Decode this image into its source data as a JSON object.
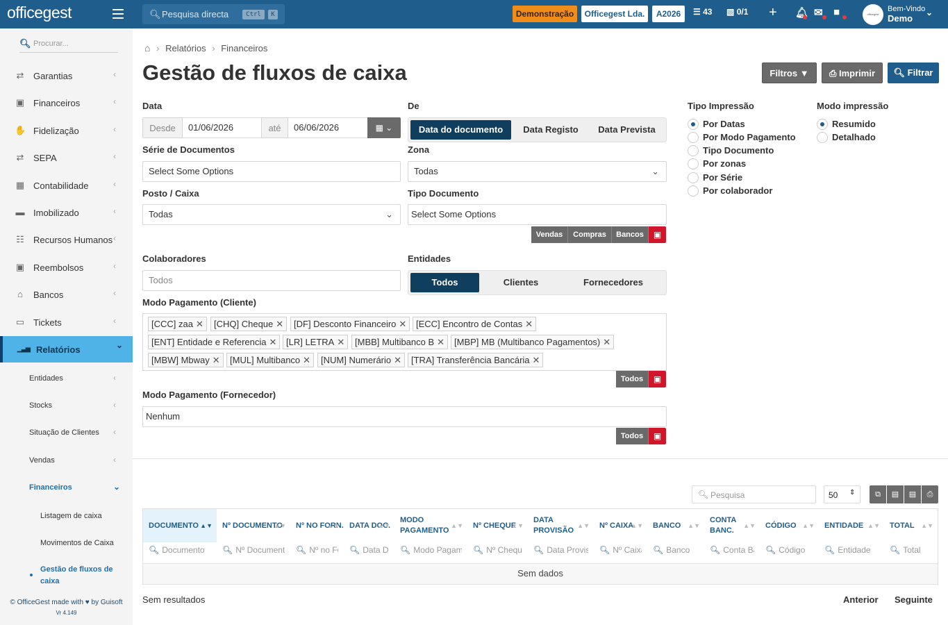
{
  "topbar": {
    "logo": "officegest",
    "search_placeholder": "Pesquisa directa",
    "kbd_ctrl": "Ctrl",
    "kbd_k": "K",
    "demo_badge": "Demonstração",
    "company": "Officegest Lda.",
    "year": "A2026",
    "tasks_count": "43",
    "folders_count": "0/1",
    "welcome": "Bem-Vindo",
    "user": "Demo"
  },
  "sidebar": {
    "search_placeholder": "Procurar...",
    "items": [
      {
        "label": "Garantias",
        "icon": "arrows-exchange-icon"
      },
      {
        "label": "Financeiros",
        "icon": "money-icon"
      },
      {
        "label": "Fidelização",
        "icon": "hand-coin-icon"
      },
      {
        "label": "SEPA",
        "icon": "arrows-exchange-icon"
      },
      {
        "label": "Contabilidade",
        "icon": "calculator-icon"
      },
      {
        "label": "Imobilizado",
        "icon": "truck-icon"
      },
      {
        "label": "Recursos Humanos",
        "icon": "sitemap-icon"
      },
      {
        "label": "Reembolsos",
        "icon": "money-icon"
      },
      {
        "label": "Bancos",
        "icon": "bank-icon"
      },
      {
        "label": "Tickets",
        "icon": "ticket-icon"
      },
      {
        "label": "Relatórios",
        "icon": "chart-icon"
      }
    ],
    "subitems": [
      "Entidades",
      "Stocks",
      "Situação de Clientes",
      "Vendas",
      "Financeiros"
    ],
    "subsub": [
      "Listagem de caixa",
      "Movimentos de Caixa",
      "Gestão de fluxos de caixa"
    ],
    "footer": "© OfficeGest made with ♥ by Guisoft",
    "version": "Vr 4.149"
  },
  "breadcrumb": {
    "home": "home-icon",
    "b1": "Relatórios",
    "b2": "Financeiros"
  },
  "page_title": "Gestão de fluxos de caixa",
  "actions": {
    "filters": "Filtros",
    "print": "Imprimir",
    "filter": "Filtrar"
  },
  "form": {
    "data_label": "Data",
    "from_label": "Desde",
    "from_value": "01/06/2026",
    "to_label": "até",
    "to_value": "06/06/2026",
    "de_label": "De",
    "de_options": [
      "Data do documento",
      "Data Registo",
      "Data Prevista"
    ],
    "serie_label": "Série de Documentos",
    "serie_placeholder": "Select Some Options",
    "zona_label": "Zona",
    "zona_value": "Todas",
    "posto_label": "Posto / Caixa",
    "posto_value": "Todas",
    "tipo_label": "Tipo Documento",
    "tipo_placeholder": "Select Some Options",
    "tipo_buttons": [
      "Vendas",
      "Compras",
      "Bancos"
    ],
    "colab_label": "Colaboradores",
    "colab_placeholder": "Todos",
    "entidades_label": "Entidades",
    "entidades_options": [
      "Todos",
      "Clientes",
      "Fornecedores"
    ],
    "modo_cliente_label": "Modo Pagamento (Cliente)",
    "modo_cliente_tags": [
      "[CCC] zaa",
      "[CHQ] Cheque",
      "[DF] Desconto Financeiro",
      "[ECC] Encontro de Contas",
      "[ENT] Entidade e Referencia",
      "[LR] LETRA",
      "[MBB] Multibanco B",
      "[MBP] MB (Multibanco Pagamentos)",
      "[MBW] Mbway",
      "[MUL] Multibanco",
      "[NUM] Numerário",
      "[TRA] Transferência Bancária"
    ],
    "todos_button": "Todos",
    "modo_fornecedor_label": "Modo Pagamento (Fornecedor)",
    "modo_fornecedor_value": "Nenhum"
  },
  "impressao": {
    "tipo_label": "Tipo Impressão",
    "tipo_options": [
      "Por Datas",
      "Por Modo Pagamento",
      "Tipo Documento",
      "Por zonas",
      "Por Série",
      "Por colaborador"
    ],
    "modo_label": "Modo impressão",
    "modo_options": [
      "Resumido",
      "Detalhado"
    ]
  },
  "table": {
    "search_placeholder": "Pesquisa",
    "page_size": "50",
    "columns": [
      "DOCUMENTO",
      "Nº DOCUMENTO",
      "Nº NO FORN.",
      "DATA DOC.",
      "MODO PAGAMENTO",
      "Nº CHEQUE",
      "DATA PROVISÃO",
      "Nº CAIXA",
      "BANCO",
      "CONTA BANC.",
      "CÓDIGO",
      "ENTIDADE",
      "TOTAL"
    ],
    "filters": [
      "Documento",
      "Nº Documento",
      "Nº no Fornecedor",
      "Data Doc.",
      "Modo Pagamento",
      "Nº Cheque",
      "Data Provisão",
      "Nº Caixa",
      "Banco",
      "Conta Bancária",
      "Código",
      "Entidade",
      "Total"
    ],
    "empty": "Sem dados"
  },
  "footer_bar": {
    "results": "Sem resultados",
    "prev": "Anterior",
    "next": "Seguinte"
  }
}
